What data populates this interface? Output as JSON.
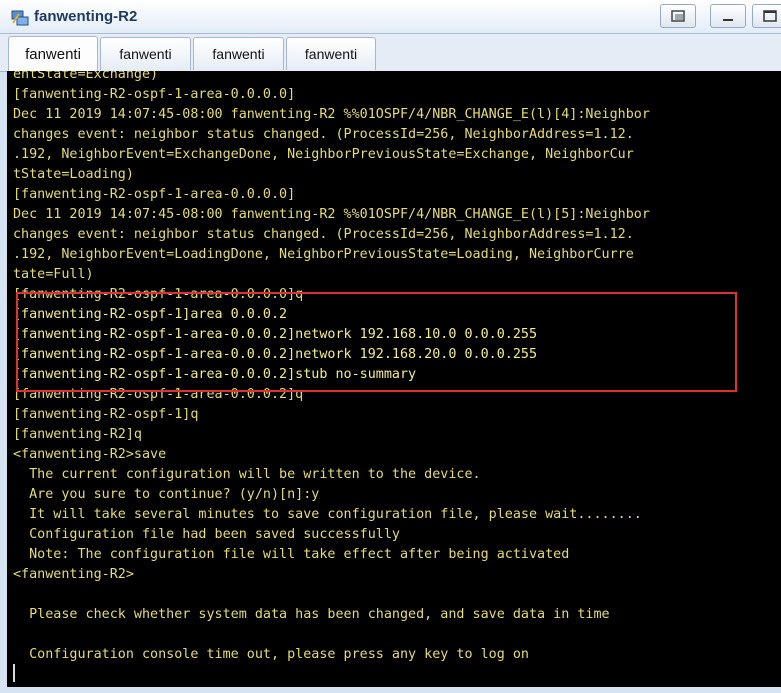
{
  "window": {
    "title": "fanwenting-R2",
    "controls": [
      "restore-icon",
      "minimize-icon",
      "maximize-icon"
    ]
  },
  "tabs": [
    {
      "label": "fanwenti",
      "active": true
    },
    {
      "label": "fanwenti",
      "active": false
    },
    {
      "label": "fanwenti",
      "active": false
    },
    {
      "label": "fanwenti",
      "active": false
    }
  ],
  "terminal": {
    "text_color": "#e6db74",
    "background": "#000000",
    "highlight_color": "#e03131",
    "lines": [
      "entState=Exchange)",
      "[fanwenting-R2-ospf-1-area-0.0.0.0]",
      "Dec 11 2019 14:07:45-08:00 fanwenting-R2 %%01OSPF/4/NBR_CHANGE_E(l)[4]:Neighbor",
      "changes event: neighbor status changed. (ProcessId=256, NeighborAddress=1.12.",
      ".192, NeighborEvent=ExchangeDone, NeighborPreviousState=Exchange, NeighborCur",
      "tState=Loading)",
      "[fanwenting-R2-ospf-1-area-0.0.0.0]",
      "Dec 11 2019 14:07:45-08:00 fanwenting-R2 %%01OSPF/4/NBR_CHANGE_E(l)[5]:Neighbor",
      "changes event: neighbor status changed. (ProcessId=256, NeighborAddress=1.12.",
      ".192, NeighborEvent=LoadingDone, NeighborPreviousState=Loading, NeighborCurre",
      "tate=Full)",
      "[fanwenting-R2-ospf-1-area-0.0.0.0]q",
      "[fanwenting-R2-ospf-1]area 0.0.0.2",
      "[fanwenting-R2-ospf-1-area-0.0.0.2]network 192.168.10.0 0.0.0.255",
      "[fanwenting-R2-ospf-1-area-0.0.0.2]network 192.168.20.0 0.0.0.255",
      "[fanwenting-R2-ospf-1-area-0.0.0.2]stub no-summary",
      "[fanwenting-R2-ospf-1-area-0.0.0.2]q",
      "[fanwenting-R2-ospf-1]q",
      "[fanwenting-R2]q",
      "<fanwenting-R2>save",
      "  The current configuration will be written to the device.",
      "  Are you sure to continue? (y/n)[n]:y",
      "  It will take several minutes to save configuration file, please wait........",
      "  Configuration file had been saved successfully",
      "  Note: The configuration file will take effect after being activated",
      "<fanwenting-R2>",
      "",
      "  Please check whether system data has been changed, and save data in time",
      "",
      "  Configuration console time out, please press any key to log on"
    ]
  }
}
